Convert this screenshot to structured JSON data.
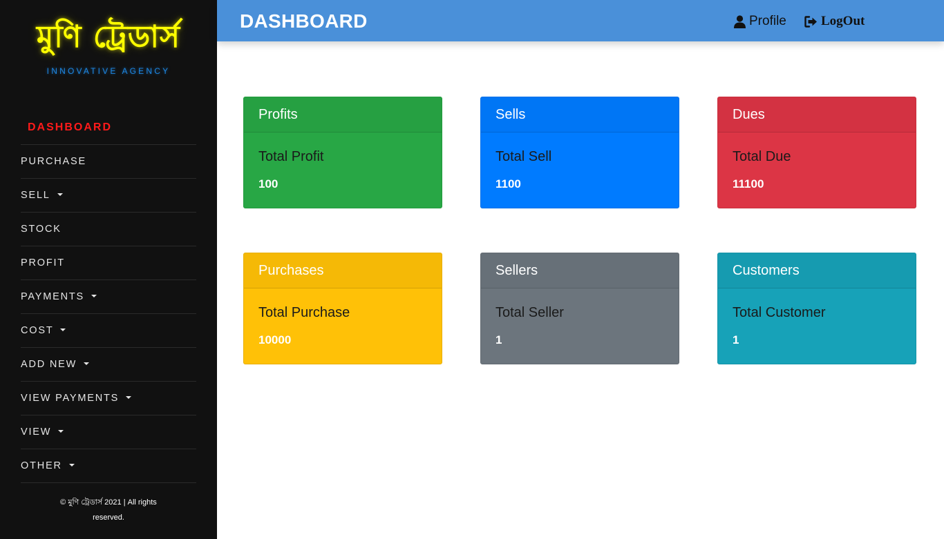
{
  "brand": {
    "name": "মুণি ট্রেডার্স",
    "tagline": "INNOVATIVE AGENCY"
  },
  "sidebar": {
    "items": [
      {
        "label": "DASHBOARD",
        "active": true,
        "dropdown": false
      },
      {
        "label": "PURCHASE",
        "active": false,
        "dropdown": false
      },
      {
        "label": "SELL",
        "active": false,
        "dropdown": true
      },
      {
        "label": "STOCK",
        "active": false,
        "dropdown": false
      },
      {
        "label": "PROFIT",
        "active": false,
        "dropdown": false
      },
      {
        "label": "PAYMENTS",
        "active": false,
        "dropdown": true
      },
      {
        "label": "COST",
        "active": false,
        "dropdown": true
      },
      {
        "label": "ADD NEW",
        "active": false,
        "dropdown": true
      },
      {
        "label": "VIEW PAYMENTS",
        "active": false,
        "dropdown": true
      },
      {
        "label": "VIEW",
        "active": false,
        "dropdown": true
      },
      {
        "label": "OTHER",
        "active": false,
        "dropdown": true
      }
    ],
    "copyright": "© মুণি ট্রেডার্স 2021 | All rights reserved."
  },
  "header": {
    "title": "DASHBOARD",
    "profile_label": "Profile",
    "logout_label": "LogOut"
  },
  "cards": [
    {
      "title": "Profits",
      "label": "Total Profit",
      "value": "100",
      "color": "#28a745"
    },
    {
      "title": "Sells",
      "label": "Total Sell",
      "value": "1100",
      "color": "#007bff"
    },
    {
      "title": "Dues",
      "label": "Total Due",
      "value": "11100",
      "color": "#dc3545"
    },
    {
      "title": "Purchases",
      "label": "Total Purchase",
      "value": "10000",
      "color": "#ffc107"
    },
    {
      "title": "Sellers",
      "label": "Total Seller",
      "value": "1",
      "color": "#6c757d"
    },
    {
      "title": "Customers",
      "label": "Total Customer",
      "value": "1",
      "color": "#17a2b8"
    }
  ],
  "colors": {
    "sidebar_bg": "#111111",
    "topbar_bg": "#4a90d9",
    "active_nav": "#ff1a1a",
    "brand_text": "#ffff00",
    "tagline": "#1e88e5"
  },
  "icons": {
    "profile": "user-icon",
    "logout": "sign-out-icon",
    "dropdown": "caret-down-icon"
  }
}
